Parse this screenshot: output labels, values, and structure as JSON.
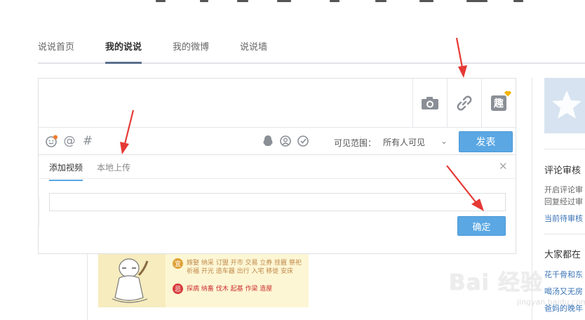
{
  "tabs": [
    {
      "label": "说说首页",
      "active": false
    },
    {
      "label": "我的说说",
      "active": true
    },
    {
      "label": "我的微博",
      "active": false
    },
    {
      "label": "说说墙",
      "active": false
    }
  ],
  "composer": {
    "media_buttons": [
      "camera-icon",
      "link-icon",
      "fun-icon"
    ],
    "fun_label": "趣",
    "toolbar_icons": [
      "emoji-icon",
      "mention-icon",
      "hashtag-icon",
      "qq-icon",
      "location-icon",
      "time-icon"
    ],
    "mention_glyph": "@",
    "hashtag_glyph": "#",
    "visibility_label": "可见范围：",
    "visibility_value": "所有人可见",
    "publish_label": "发表"
  },
  "video_panel": {
    "tabs": [
      "添加视频",
      "本地上传"
    ],
    "active_tab": 0,
    "url_value": "",
    "confirm_label": "确定",
    "close_glyph": "✕"
  },
  "almanac": {
    "yi_badge": "宜",
    "yi_line1": "嫁娶 纳采 订盟 开市 交易 立券 挂匾 祭祀",
    "yi_line2": "祈福 开光 造车器 出行 入宅 移徙 安床",
    "ji_badge": "忌",
    "ji_text": "探病 纳畜 伐木 起基 作梁 造屋"
  },
  "sidebar": {
    "section1_title": "评论审核",
    "section1_line1": "开启评论审",
    "section1_line2": "回复经过审",
    "section1_link": "当前待审核",
    "section2_title": "大家都在",
    "links": [
      "花千骨和东",
      "喝汤又无房",
      "爸妈的晚年"
    ]
  },
  "watermark": {
    "main": "Bai 经验",
    "sub": "jingyan.baidu.com"
  },
  "colors": {
    "accent": "#5aa7e3",
    "annotation_arrow": "#e53935",
    "tab_underline": "#5b6f8c"
  }
}
